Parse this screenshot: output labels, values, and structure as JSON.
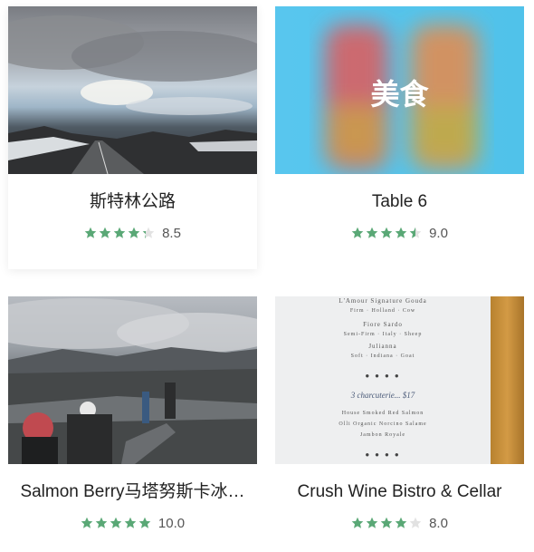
{
  "colors": {
    "star_on": "#5aa876",
    "star_off": "#e2e2e2",
    "title": "#222222",
    "score": "#555555"
  },
  "cards": [
    {
      "title": "斯特林公路",
      "rating": 8.5,
      "score_text": "8.5",
      "overlay": ""
    },
    {
      "title": "Table 6",
      "rating": 9.0,
      "score_text": "9.0",
      "overlay": "美食"
    },
    {
      "title": "Salmon Berry马塔努斯卡冰…",
      "rating": 10.0,
      "score_text": "10.0",
      "overlay": ""
    },
    {
      "title": "Crush Wine Bistro & Cellar",
      "rating": 8.0,
      "score_text": "8.0",
      "overlay": ""
    }
  ],
  "menu": {
    "lines": [
      "L'Amour Signature Gouda",
      "Firm · Holland · Cow",
      "Fiore Sardo",
      "Semi-Firm · Italy · Sheep",
      "Julianna",
      "Soft · Indiana · Goat",
      "3 charcuterie... $17",
      "House Smoked Red Salmon",
      "Olli Organic Norcino Salame",
      "Jambon Royale"
    ]
  }
}
